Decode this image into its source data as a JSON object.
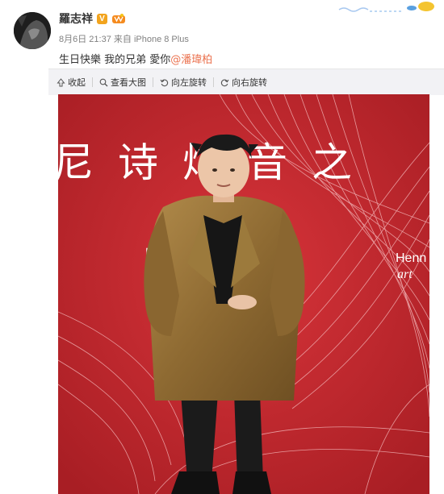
{
  "user": {
    "name": "羅志祥",
    "verified_badge": "V",
    "vip_icon": "vip-crown-icon"
  },
  "post": {
    "date": "8月6日 21:37",
    "source_prefix": "来自",
    "source": "iPhone 8 Plus",
    "text_prefix": "生日快樂 我的兄弟 愛你",
    "mention": "@潘瑋柏"
  },
  "toolbar": {
    "collapse": "收起",
    "view_large": "查看大图",
    "rotate_left": "向左旋转",
    "rotate_right": "向右旋转"
  },
  "photo": {
    "backdrop_text": "尼诗炫音之",
    "brand_text": "Henn",
    "brand_script": "art",
    "left_text": "H"
  },
  "colors": {
    "mention": "#eb7350",
    "toolbar_bg": "#f2f2f5",
    "backdrop_red": "#c4262c",
    "badge": "#f2a41e"
  }
}
